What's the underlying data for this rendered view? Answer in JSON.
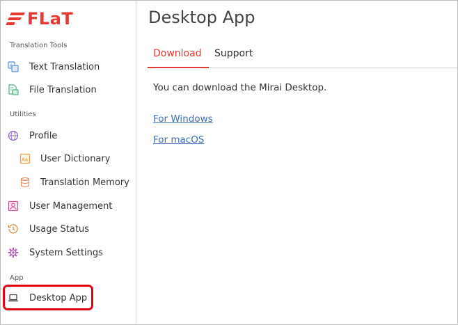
{
  "brand": {
    "name": "FLaT",
    "color": "#e53935"
  },
  "sidebar": {
    "sections": [
      {
        "label": "Translation Tools"
      },
      {
        "label": "Utilities"
      },
      {
        "label": "App"
      }
    ],
    "items": [
      {
        "label": "Text Translation",
        "icon": "text-translation-icon"
      },
      {
        "label": "File Translation",
        "icon": "file-translation-icon"
      },
      {
        "label": "Profile",
        "icon": "globe-icon"
      },
      {
        "label": "User Dictionary",
        "icon": "dictionary-icon"
      },
      {
        "label": "Translation Memory",
        "icon": "database-icon"
      },
      {
        "label": "User Management",
        "icon": "user-card-icon"
      },
      {
        "label": "Usage Status",
        "icon": "history-clock-icon"
      },
      {
        "label": "System Settings",
        "icon": "gear-icon"
      },
      {
        "label": "Desktop App",
        "icon": "laptop-icon",
        "selected": true
      }
    ],
    "highlight_color": "#e0000f"
  },
  "main": {
    "title": "Desktop App",
    "tabs": [
      {
        "label": "Download",
        "active": true
      },
      {
        "label": "Support",
        "active": false
      }
    ],
    "description": "You can download the Mirai Desktop.",
    "links": [
      {
        "label": "For Windows"
      },
      {
        "label": "For macOS"
      }
    ],
    "link_color": "#3c6fb5"
  }
}
